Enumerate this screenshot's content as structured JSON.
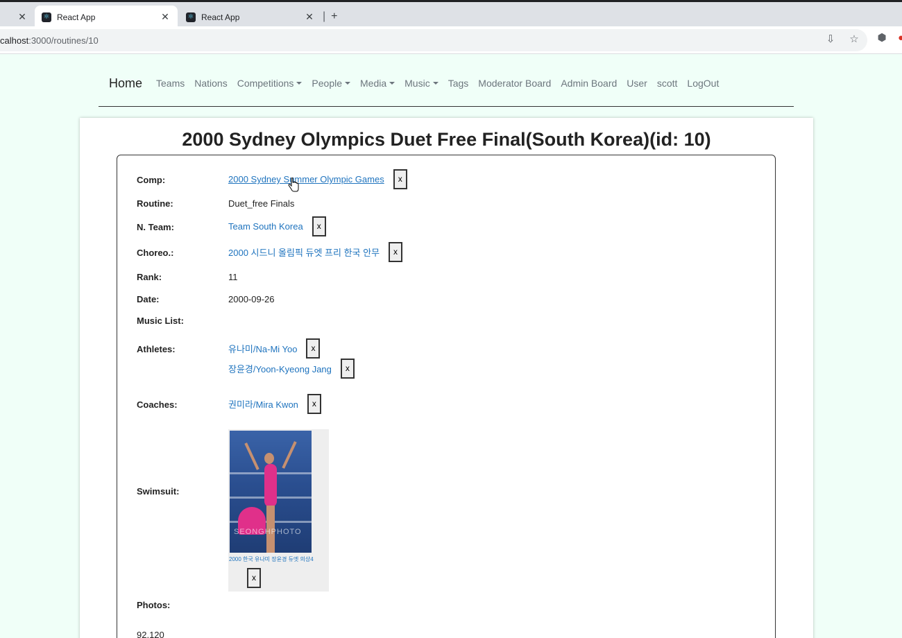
{
  "browser": {
    "tabs": [
      {
        "title": "React App",
        "active": true
      },
      {
        "title": "React App",
        "active": false
      }
    ],
    "new_tab": "+",
    "url_host": "calhost",
    "url_path": ":3000/routines/10"
  },
  "nav": {
    "brand": "Home",
    "links": [
      "Teams",
      "Nations"
    ],
    "dropdowns": [
      "Competitions",
      "People",
      "Media",
      "Music"
    ],
    "links_after": [
      "Tags",
      "Moderator Board",
      "Admin Board",
      "User",
      "scott",
      "LogOut"
    ]
  },
  "page": {
    "title": "2000 Sydney Olympics Duet Free Final(South Korea)(id: 10)",
    "fields": {
      "comp_label": "Comp:",
      "comp_value": "2000 Sydney Summer Olympic Games",
      "routine_label": "Routine:",
      "routine_value": "Duet_free Finals",
      "team_label": "N. Team:",
      "team_value": "Team South Korea",
      "choreo_label": "Choreo.:",
      "choreo_value": "2000 시드니 올림픽 듀엣 프리 한국 안무",
      "rank_label": "Rank:",
      "rank_value": "11",
      "date_label": "Date:",
      "date_value": "2000-09-26",
      "music_label": "Music List:",
      "athletes_label": "Athletes:",
      "athletes": [
        "유나미/Na-Mi Yoo",
        "장윤경/Yoon-Kyeong Jang"
      ],
      "coaches_label": "Coaches:",
      "coaches": [
        "권미라/Mira Kwon"
      ],
      "swimsuit_label": "Swimsuit:",
      "swimsuit_caption": "2000 한국 유나미 장윤경 듀엣 의상4",
      "swimsuit_watermark": "SEONGHPHOTO",
      "photos_label": "Photos:",
      "photos_value": "92,120"
    },
    "remove_label": "x"
  }
}
